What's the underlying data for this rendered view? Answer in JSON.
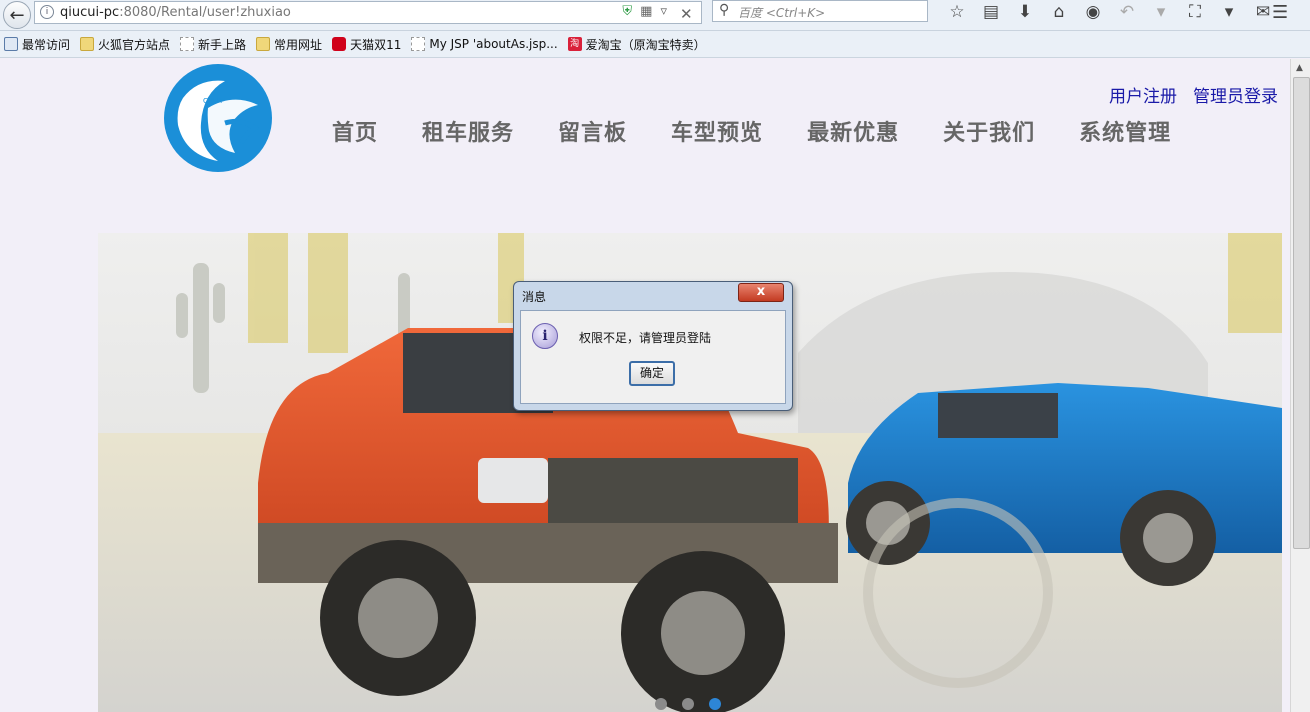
{
  "browser": {
    "url_host": "qiucui-pc",
    "url_rest": ":8080/Rental/user!zhuxiao",
    "search_placeholder": "百度 <Ctrl+K>"
  },
  "bookmarks": [
    {
      "label": "最常访问",
      "icon": "star-icon"
    },
    {
      "label": "火狐官方站点",
      "icon": "folder-icon"
    },
    {
      "label": "新手上路",
      "icon": "page-icon"
    },
    {
      "label": "常用网址",
      "icon": "folder-icon"
    },
    {
      "label": "天猫双11",
      "icon": "tmall-icon"
    },
    {
      "label": "My JSP 'aboutAs.jsp...",
      "icon": "page-icon"
    },
    {
      "label": "爱淘宝（原淘宝特卖）",
      "icon": "taobao-icon"
    }
  ],
  "header": {
    "register": "用户注册",
    "admin_login": "管理员登录"
  },
  "nav": [
    "首页",
    "租车服务",
    "留言板",
    "车型预览",
    "最新优惠",
    "关于我们",
    "系统管理"
  ],
  "carousel": {
    "slide_count": 3,
    "active_index": 2
  },
  "dialog": {
    "title": "消息",
    "close": "x",
    "message": "权限不足，请管理员登陆",
    "ok": "确定"
  },
  "colors": {
    "accent": "#2d86d6",
    "nav_text": "#666666",
    "link": "#1a1aa8",
    "logo": "#1b8fd8"
  }
}
